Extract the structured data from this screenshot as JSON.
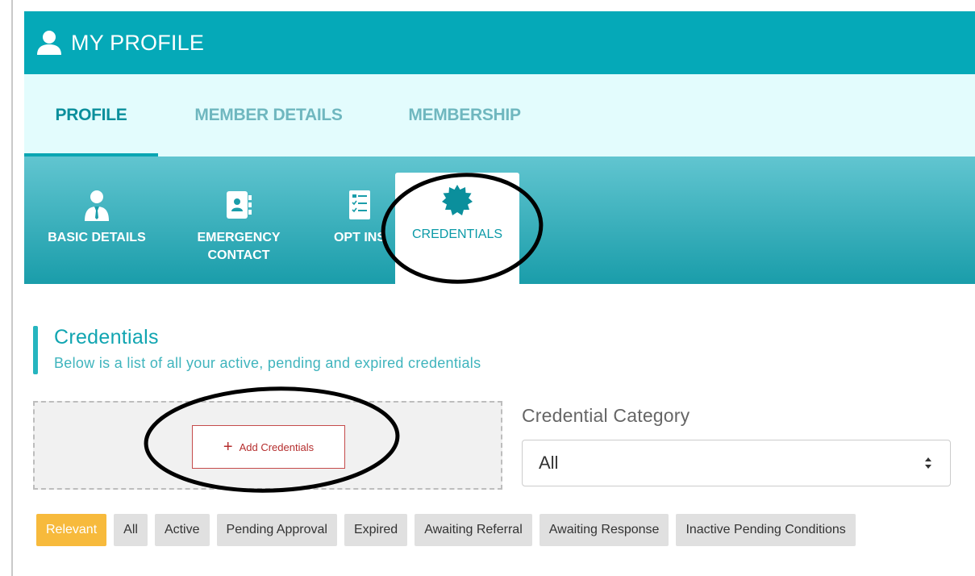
{
  "header": {
    "title": "MY PROFILE",
    "icon": "user-icon"
  },
  "tabs": [
    {
      "label": "PROFILE",
      "active": true
    },
    {
      "label": "MEMBER DETAILS",
      "active": false
    },
    {
      "label": "MEMBERSHIP",
      "active": false
    }
  ],
  "subtabs": [
    {
      "label": "BASIC DETAILS",
      "icon": "person-tie-icon",
      "active": false
    },
    {
      "label": "EMERGENCY CONTACT",
      "line1": "EMERGENCY",
      "line2": "CONTACT",
      "icon": "contact-book-icon",
      "active": false
    },
    {
      "label": "OPT INS",
      "icon": "checklist-icon",
      "active": false
    },
    {
      "label": "CREDENTIALS",
      "icon": "badge-seal-icon",
      "active": true
    }
  ],
  "credentials": {
    "title": "Credentials",
    "subtitle": "Below is a list of all your active, pending and expired credentials",
    "add_button": "Add Credentials",
    "category_label": "Credential Category",
    "category_selected": "All"
  },
  "filters": [
    {
      "label": "Relevant",
      "active": true
    },
    {
      "label": "All",
      "active": false
    },
    {
      "label": "Active",
      "active": false
    },
    {
      "label": "Pending Approval",
      "active": false
    },
    {
      "label": "Expired",
      "active": false
    },
    {
      "label": "Awaiting Referral",
      "active": false
    },
    {
      "label": "Awaiting Response",
      "active": false
    },
    {
      "label": "Inactive Pending Conditions",
      "active": false
    }
  ],
  "colors": {
    "header_bg": "#05a9b8",
    "tabs_bg": "#e3fcfd",
    "accent": "#0aa6b3",
    "active_filter": "#f7ba3c",
    "add_button_border": "#c54b4b"
  }
}
